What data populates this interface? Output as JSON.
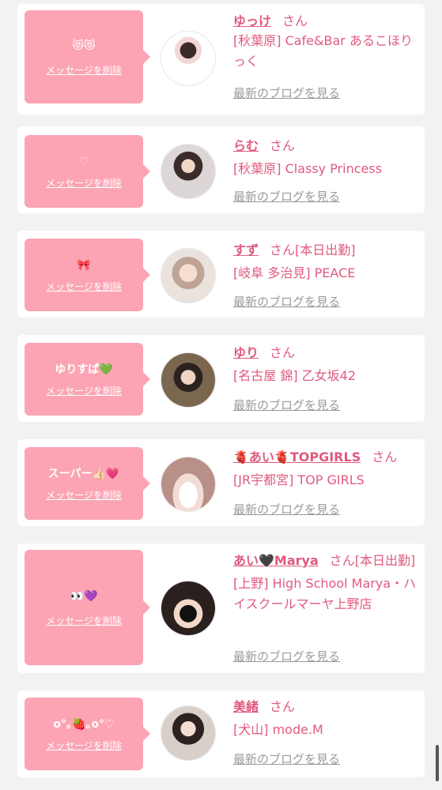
{
  "delete_label": "メッセージを削除",
  "blog_label": "最新のブログを見る",
  "honorific": "さん",
  "cards": [
    {
      "message": "😻😻",
      "name": "ゆっけ",
      "status": "",
      "shop": "[秋葉原] Cafe&Bar あるこほりっく"
    },
    {
      "message": "♡",
      "name": "らむ",
      "status": "",
      "shop": "[秋葉原] Classy Princess"
    },
    {
      "message": "🎀",
      "name": "すず",
      "status": "[本日出勤]",
      "shop": "[岐阜 多治見] PEACE"
    },
    {
      "message": "ゆりすぱ💚",
      "name": "ゆり",
      "status": "",
      "shop": "[名古屋 錦] 乙女坂42"
    },
    {
      "message": "スーパー👍🏻💗",
      "name": "🫀あい🫀TOPGIRLS",
      "status": "",
      "shop": "[JR宇都宮] TOP GIRLS"
    },
    {
      "message": "👀💜",
      "name": "あい🖤Marya",
      "status": "[本日出勤]",
      "shop": "[上野] High School Marya・ハイスクールマーヤ上野店"
    },
    {
      "message": "o°｡🍓｡o°♡",
      "name": "美緒",
      "status": "",
      "shop": "[犬山] mode.M"
    }
  ]
}
